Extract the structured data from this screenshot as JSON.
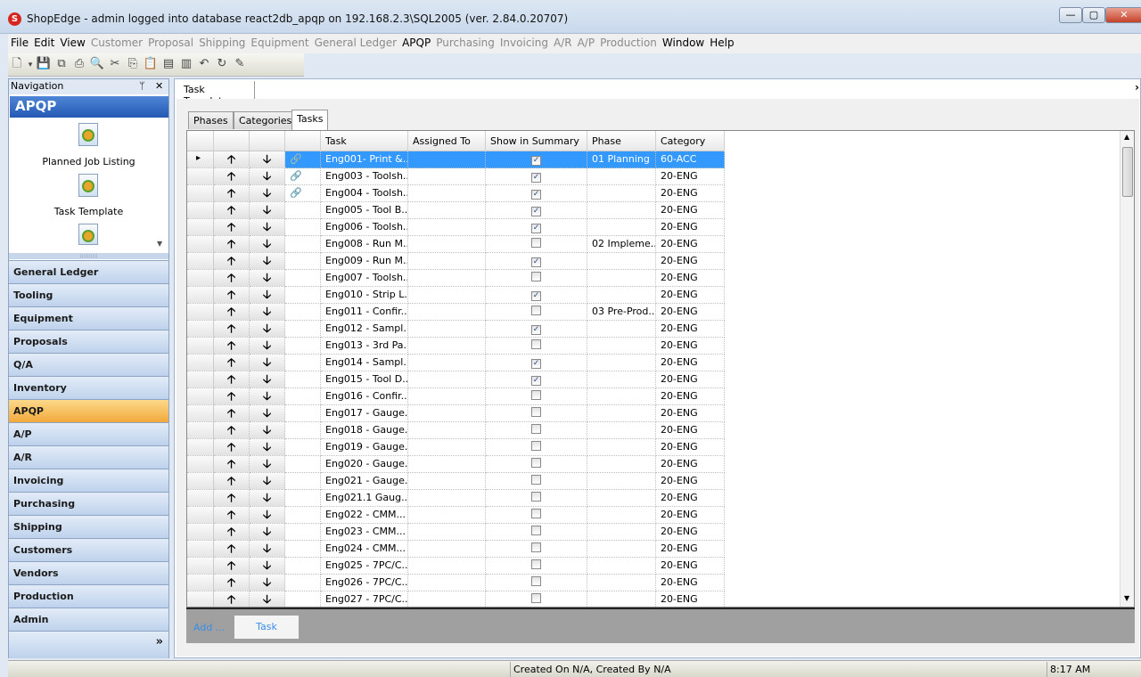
{
  "window": {
    "title": "ShopEdge - admin logged into database react2db_apqp on 192.168.2.3\\SQL2005 (ver. 2.84.0.20707)",
    "minimize": "—",
    "maximize": "▢",
    "close": "✕"
  },
  "menu": [
    {
      "label": "File",
      "enabled": true
    },
    {
      "label": "Edit",
      "enabled": true
    },
    {
      "label": "View",
      "enabled": true
    },
    {
      "label": "Customer",
      "enabled": false
    },
    {
      "label": "Proposal",
      "enabled": false
    },
    {
      "label": "Shipping",
      "enabled": false
    },
    {
      "label": "Equipment",
      "enabled": false
    },
    {
      "label": "General Ledger",
      "enabled": false
    },
    {
      "label": "APQP",
      "enabled": true
    },
    {
      "label": "Purchasing",
      "enabled": false
    },
    {
      "label": "Invoicing",
      "enabled": false
    },
    {
      "label": "A/R",
      "enabled": false
    },
    {
      "label": "A/P",
      "enabled": false
    },
    {
      "label": "Production",
      "enabled": false
    },
    {
      "label": "Window",
      "enabled": true
    },
    {
      "label": "Help",
      "enabled": true
    }
  ],
  "toolbar": [
    {
      "icon": "new-icon",
      "glyph": "🗋"
    },
    {
      "icon": "dropdown-icon",
      "glyph": "▾"
    },
    {
      "icon": "save-icon",
      "glyph": "💾"
    },
    {
      "icon": "save-all-icon",
      "glyph": "⧉"
    },
    {
      "icon": "print-icon",
      "glyph": "⎙"
    },
    {
      "icon": "print-preview-icon",
      "glyph": "🔍"
    },
    {
      "icon": "cut-icon",
      "glyph": "✂"
    },
    {
      "icon": "copy-icon",
      "glyph": "⎘"
    },
    {
      "icon": "paste-icon",
      "glyph": "📋"
    },
    {
      "icon": "add-record-icon",
      "glyph": "▤"
    },
    {
      "icon": "delete-record-icon",
      "glyph": "▥"
    },
    {
      "icon": "undo-icon",
      "glyph": "↶"
    },
    {
      "icon": "refresh-icon",
      "glyph": "↻"
    },
    {
      "icon": "edit-icon",
      "glyph": "✎"
    }
  ],
  "navigation": {
    "title": "Navigation",
    "pin": "ᛘ",
    "close": "✕",
    "section": "APQP",
    "items": [
      {
        "label": "Planned Job Listing"
      },
      {
        "label": "Task Template"
      }
    ],
    "splitter": "::::::::::",
    "modules": [
      "General Ledger",
      "Tooling",
      "Equipment",
      "Proposals",
      "Q/A",
      "Inventory",
      "APQP",
      "A/P",
      "A/R",
      "Invoicing",
      "Purchasing",
      "Shipping",
      "Customers",
      "Vendors",
      "Production",
      "Admin"
    ],
    "selected_module": "APQP",
    "more": "»"
  },
  "document_tab": "Task Template",
  "close_doc": "›",
  "tabs": [
    {
      "label": "Phases"
    },
    {
      "label": "Categories"
    },
    {
      "label": "Tasks"
    }
  ],
  "active_tab": "Tasks",
  "grid": {
    "columns": [
      "Task",
      "Assigned To",
      "Show in Summary",
      "Phase",
      "Category"
    ],
    "up": "🡡",
    "down": "🡣",
    "current_marker": "▸",
    "rows": [
      {
        "task": "Eng001- Print &...",
        "assigned": "",
        "show": true,
        "phase": "01 Planning",
        "category": "60-ACC",
        "link": true,
        "selected": true
      },
      {
        "task": "Eng003 - Toolsh...",
        "assigned": "",
        "show": true,
        "phase": "",
        "category": "20-ENG",
        "link": true
      },
      {
        "task": "Eng004 - Toolsh...",
        "assigned": "",
        "show": true,
        "phase": "",
        "category": "20-ENG",
        "link": true
      },
      {
        "task": "Eng005 - Tool B...",
        "assigned": "",
        "show": true,
        "phase": "",
        "category": "20-ENG"
      },
      {
        "task": "Eng006 - Toolsh...",
        "assigned": "",
        "show": true,
        "phase": "",
        "category": "20-ENG"
      },
      {
        "task": "Eng008 - Run M...",
        "assigned": "",
        "show": false,
        "phase": "02 Impleme...",
        "category": "20-ENG"
      },
      {
        "task": "Eng009 - Run M...",
        "assigned": "",
        "show": true,
        "phase": "",
        "category": "20-ENG"
      },
      {
        "task": "Eng007 - Toolsh...",
        "assigned": "",
        "show": false,
        "phase": "",
        "category": "20-ENG"
      },
      {
        "task": "Eng010 - Strip L...",
        "assigned": "",
        "show": true,
        "phase": "",
        "category": "20-ENG"
      },
      {
        "task": "Eng011 - Confir...",
        "assigned": "",
        "show": false,
        "phase": "03 Pre-Prod...",
        "category": "20-ENG"
      },
      {
        "task": "Eng012 - Sampl...",
        "assigned": "",
        "show": true,
        "phase": "",
        "category": "20-ENG"
      },
      {
        "task": "Eng013 - 3rd Pa...",
        "assigned": "",
        "show": false,
        "phase": "",
        "category": "20-ENG"
      },
      {
        "task": "Eng014 - Sampl...",
        "assigned": "",
        "show": true,
        "phase": "",
        "category": "20-ENG"
      },
      {
        "task": "Eng015 - Tool D...",
        "assigned": "",
        "show": true,
        "phase": "",
        "category": "20-ENG"
      },
      {
        "task": "Eng016 - Confir...",
        "assigned": "",
        "show": false,
        "phase": "",
        "category": "20-ENG"
      },
      {
        "task": "Eng017 - Gauge...",
        "assigned": "",
        "show": false,
        "phase": "",
        "category": "20-ENG"
      },
      {
        "task": "Eng018 - Gauge...",
        "assigned": "",
        "show": false,
        "phase": "",
        "category": "20-ENG"
      },
      {
        "task": "Eng019 - Gauge...",
        "assigned": "",
        "show": false,
        "phase": "",
        "category": "20-ENG"
      },
      {
        "task": "Eng020 - Gauge...",
        "assigned": "",
        "show": false,
        "phase": "",
        "category": "20-ENG"
      },
      {
        "task": "Eng021 - Gauge...",
        "assigned": "",
        "show": false,
        "phase": "",
        "category": "20-ENG"
      },
      {
        "task": "Eng021.1 Gaug...",
        "assigned": "",
        "show": false,
        "phase": "",
        "category": "20-ENG"
      },
      {
        "task": "Eng022 - CMM...",
        "assigned": "",
        "show": false,
        "phase": "",
        "category": "20-ENG"
      },
      {
        "task": "Eng023 - CMM...",
        "assigned": "",
        "show": false,
        "phase": "",
        "category": "20-ENG"
      },
      {
        "task": "Eng024 - CMM...",
        "assigned": "",
        "show": false,
        "phase": "",
        "category": "20-ENG"
      },
      {
        "task": "Eng025 - 7PC/C...",
        "assigned": "",
        "show": false,
        "phase": "",
        "category": "20-ENG"
      },
      {
        "task": "Eng026 - 7PC/C...",
        "assigned": "",
        "show": false,
        "phase": "",
        "category": "20-ENG"
      },
      {
        "task": "Eng027 - 7PC/C...",
        "assigned": "",
        "show": false,
        "phase": "",
        "category": "20-ENG"
      }
    ]
  },
  "add_bar": {
    "label": "Add ...",
    "button": "Task"
  },
  "status": {
    "message": "Created On N/A, Created By N/A",
    "time": "8:17 AM"
  },
  "colors": {
    "selection": "#3399ff",
    "nav_selected": "#f2a93b",
    "nav_header": "#2359b4",
    "link_text": "#3b8ee8"
  }
}
